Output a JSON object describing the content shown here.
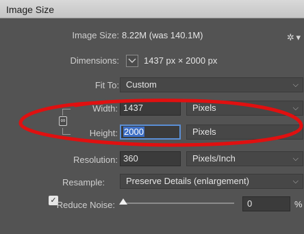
{
  "window": {
    "title": "Image Size"
  },
  "image_size": {
    "label": "Image Size:",
    "value": "8.22M (was 140.1M)"
  },
  "dimensions": {
    "label": "Dimensions:",
    "width": "1437",
    "unit_px": "px",
    "times": "×",
    "height": "2000"
  },
  "fit_to": {
    "label": "Fit To:",
    "selected": "Custom"
  },
  "width": {
    "label": "Width:",
    "value": "1437",
    "unit": "Pixels"
  },
  "height": {
    "label": "Height:",
    "value": "2000",
    "unit": "Pixels"
  },
  "resolution": {
    "label": "Resolution:",
    "value": "360",
    "unit": "Pixels/Inch"
  },
  "resample": {
    "label": "Resample:",
    "checked": true,
    "method": "Preserve Details (enlargement)"
  },
  "reduce_noise": {
    "label": "Reduce Noise:",
    "value": "0",
    "unit": "%",
    "level_percent": 0
  },
  "icons": {
    "gear": "gear-icon",
    "chain": "link-chain-icon",
    "chevron": "chevron-down-icon"
  },
  "colors": {
    "annotation": "#e01010",
    "focus": "#5a8fd6",
    "selection": "#3d6fc6"
  }
}
